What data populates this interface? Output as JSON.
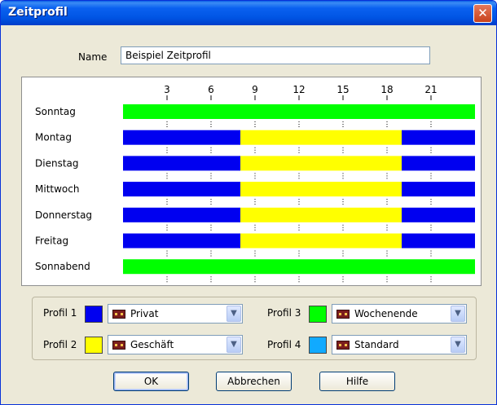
{
  "window": {
    "title": "Zeitprofil",
    "close_glyph": "✕"
  },
  "name": {
    "label": "Name",
    "value": "Beispiel Zeitprofil"
  },
  "chart_data": {
    "type": "timeline",
    "hour_ticks": [
      "3",
      "6",
      "9",
      "12",
      "15",
      "18",
      "21"
    ],
    "hours_range": [
      0,
      24
    ],
    "days": [
      {
        "label": "Sonntag",
        "segments": [
          {
            "start": 0,
            "end": 24,
            "profile": 3
          }
        ]
      },
      {
        "label": "Montag",
        "segments": [
          {
            "start": 0,
            "end": 8,
            "profile": 1
          },
          {
            "start": 8,
            "end": 19,
            "profile": 2
          },
          {
            "start": 19,
            "end": 24,
            "profile": 1
          }
        ]
      },
      {
        "label": "Dienstag",
        "segments": [
          {
            "start": 0,
            "end": 8,
            "profile": 1
          },
          {
            "start": 8,
            "end": 19,
            "profile": 2
          },
          {
            "start": 19,
            "end": 24,
            "profile": 1
          }
        ]
      },
      {
        "label": "Mittwoch",
        "segments": [
          {
            "start": 0,
            "end": 8,
            "profile": 1
          },
          {
            "start": 8,
            "end": 19,
            "profile": 2
          },
          {
            "start": 19,
            "end": 24,
            "profile": 1
          }
        ]
      },
      {
        "label": "Donnerstag",
        "segments": [
          {
            "start": 0,
            "end": 8,
            "profile": 1
          },
          {
            "start": 8,
            "end": 19,
            "profile": 2
          },
          {
            "start": 19,
            "end": 24,
            "profile": 1
          }
        ]
      },
      {
        "label": "Freitag",
        "segments": [
          {
            "start": 0,
            "end": 8,
            "profile": 1
          },
          {
            "start": 8,
            "end": 19,
            "profile": 2
          },
          {
            "start": 19,
            "end": 24,
            "profile": 1
          }
        ]
      },
      {
        "label": "Sonnabend",
        "segments": [
          {
            "start": 0,
            "end": 24,
            "profile": 3
          }
        ]
      }
    ]
  },
  "profiles": [
    {
      "label": "Profil 1",
      "color": "#0000f0",
      "selected": "Privat"
    },
    {
      "label": "Profil 2",
      "color": "#ffff00",
      "selected": "Geschäft"
    },
    {
      "label": "Profil 3",
      "color": "#00ff00",
      "selected": "Wochenende"
    },
    {
      "label": "Profil 4",
      "color": "#11aaff",
      "selected": "Standard"
    }
  ],
  "buttons": {
    "ok": "OK",
    "cancel": "Abbrechen",
    "help": "Hilfe"
  },
  "icons": {
    "dropdown": "chevron-down-icon",
    "profile": "mailbox-icon"
  }
}
